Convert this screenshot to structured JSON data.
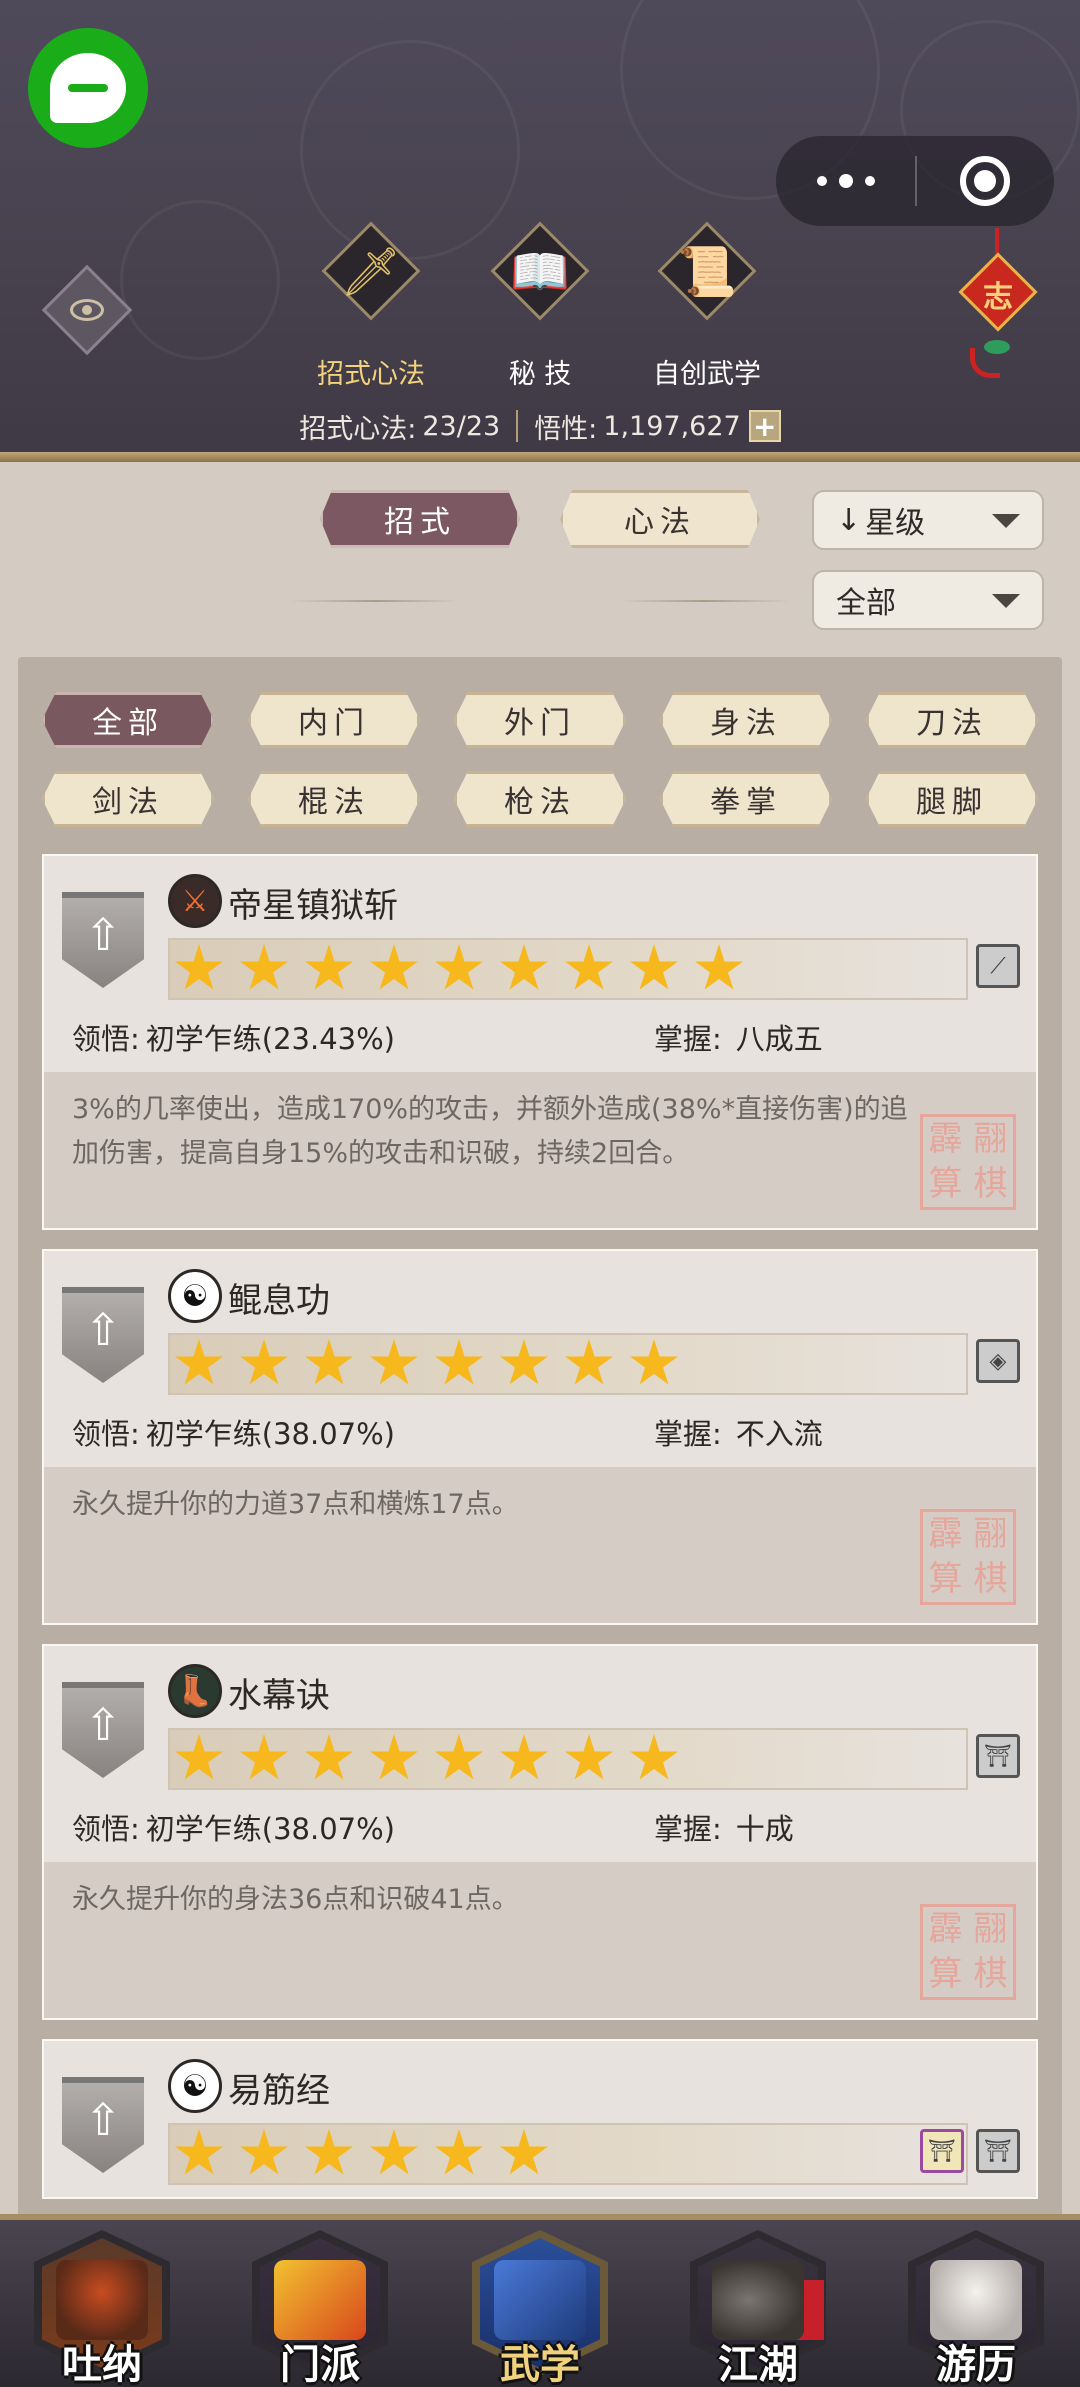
{
  "header": {
    "tabs": [
      {
        "label": "招式心法",
        "active": true,
        "icon": "sword-icon"
      },
      {
        "label": "秘 技",
        "active": false,
        "icon": "book-icon"
      },
      {
        "label": "自创武学",
        "active": false,
        "icon": "scroll-icon"
      }
    ],
    "stats": {
      "moves_label": "招式心法:",
      "moves_value": "23/23",
      "insight_label": "悟性:",
      "insight_value": "1,197,627",
      "plus": "+"
    },
    "knot_char": "志"
  },
  "filters": {
    "type_tabs": [
      "招式",
      "心法"
    ],
    "sort_dropdown": "星级",
    "sort_arrow": "↓",
    "scope_dropdown": "全部"
  },
  "categories": [
    "全部",
    "内门",
    "外门",
    "身法",
    "刀法",
    "剑法",
    "棍法",
    "枪法",
    "拳掌",
    "腿脚"
  ],
  "skills": [
    {
      "name": "帝星镇狱斩",
      "stars": 9,
      "comprehension_label": "领悟:",
      "comprehension": "初学乍练(23.43%)",
      "mastery_label": "掌握:",
      "mastery": "八成五",
      "description": "3%的几率使出，造成170%的攻击，并额外造成(38%*直接伤害)的追加伤害，提高自身15%的攻击和识破，持续2回合。",
      "seal": [
        "翮",
        "霹",
        "棋",
        "算"
      ]
    },
    {
      "name": "鲲息功",
      "stars": 8,
      "comprehension_label": "领悟:",
      "comprehension": "初学乍练(38.07%)",
      "mastery_label": "掌握:",
      "mastery": "不入流",
      "description": "永久提升你的力道37点和横炼17点。",
      "seal": [
        "翮",
        "霹",
        "棋",
        "算"
      ]
    },
    {
      "name": "水幕诀",
      "stars": 8,
      "comprehension_label": "领悟:",
      "comprehension": "初学乍练(38.07%)",
      "mastery_label": "掌握:",
      "mastery": "十成",
      "description": "永久提升你的身法36点和识破41点。",
      "seal": [
        "翮",
        "霹",
        "棋",
        "算"
      ]
    },
    {
      "name": "易筋经",
      "stars": 6
    }
  ],
  "bottom_nav": [
    {
      "label": "吐纳",
      "active": false
    },
    {
      "label": "门派",
      "active": false
    },
    {
      "label": "武学",
      "active": true
    },
    {
      "label": "江湖",
      "active": false
    },
    {
      "label": "游历",
      "active": false
    }
  ],
  "colors": {
    "header_bg": "#4f4a5a",
    "accent_gold": "#f2d27a",
    "star": "#f6b81c",
    "active_pill": "#7c5962",
    "wechat_green": "#1aad19"
  }
}
